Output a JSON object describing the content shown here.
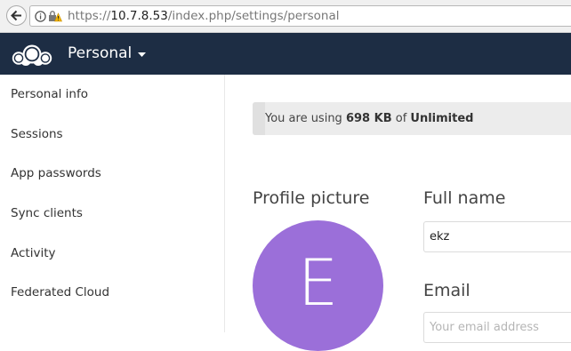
{
  "browser": {
    "url_prefix": "https://",
    "url_host": "10.7.8.53",
    "url_path": "/index.php/settings/personal"
  },
  "header": {
    "app_title": "Personal"
  },
  "sidebar": {
    "items": [
      {
        "label": "Personal info"
      },
      {
        "label": "Sessions"
      },
      {
        "label": "App passwords"
      },
      {
        "label": "Sync clients"
      },
      {
        "label": "Activity"
      },
      {
        "label": "Federated Cloud"
      }
    ]
  },
  "quota": {
    "prefix": "You are using ",
    "used": "698 KB",
    "middle": " of ",
    "total": "Unlimited"
  },
  "profile": {
    "picture_heading": "Profile picture",
    "avatar_letter": "E",
    "avatar_color": "#9b6fd9"
  },
  "fullname": {
    "heading": "Full name",
    "value": "ekz"
  },
  "email": {
    "heading": "Email",
    "placeholder": "Your email address"
  },
  "colors": {
    "header_bg": "#1d2d44"
  }
}
